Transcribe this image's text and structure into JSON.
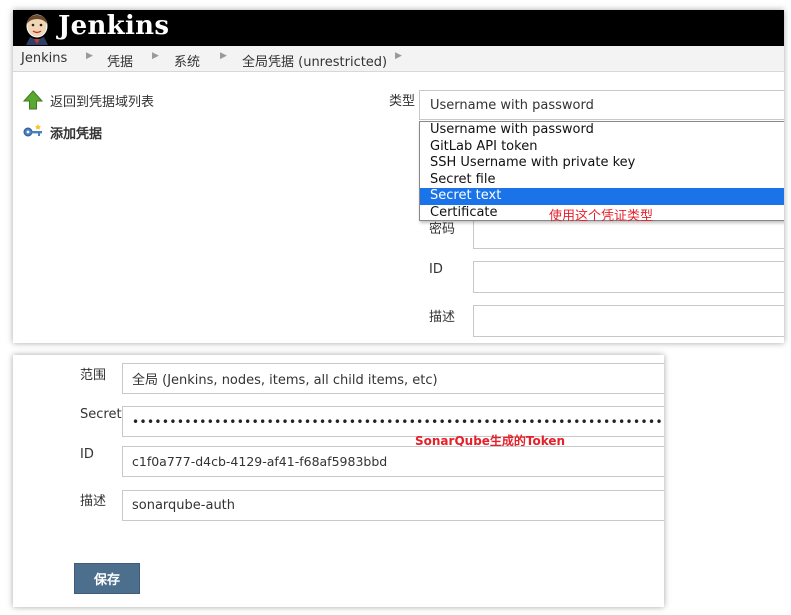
{
  "header": {
    "title": "Jenkins",
    "logo_icon": "jenkins-butler-icon"
  },
  "breadcrumb": [
    "Jenkins",
    "凭据",
    "系统",
    "全局凭据 (unrestricted)"
  ],
  "sidebar": {
    "back_label": "返回到凭据域列表",
    "back_icon": "up-arrow-icon",
    "add_label": "添加凭据",
    "add_icon": "key-icon"
  },
  "form_top": {
    "type_label": "类型",
    "type_value": "Username with password",
    "type_options": [
      "Username with password",
      "GitLab API token",
      "SSH Username with private key",
      "Secret file",
      "Secret text",
      "Certificate"
    ],
    "selected_option": "Secret text",
    "password_label_partial": "密码",
    "id_label": "ID",
    "description_label": "描述"
  },
  "annotations": {
    "type_hint": "使用这个凭证类型",
    "token_hint": "SonarQube生成的Token"
  },
  "form_bottom": {
    "scope_label": "范围",
    "scope_value": "全局 (Jenkins, nodes, items, all child items, etc)",
    "secret_label": "Secret",
    "secret_value": "••••••••••••••••••••••••••••••••••••••••••••••••••••••••••••••••••••••••••••••••••••",
    "id_label": "ID",
    "id_value": "c1f0a777-d4cb-4129-af41-f68af5983bbd",
    "description_label": "描述",
    "description_value": "sonarqube-auth",
    "save_label": "保存"
  },
  "colors": {
    "selected": "#1a73e8",
    "annotation": "#e6202a",
    "save_button": "#4d6f8e"
  }
}
